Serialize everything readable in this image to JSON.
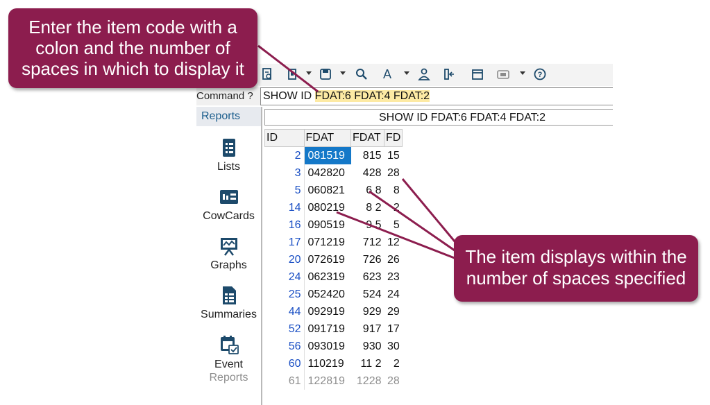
{
  "callouts": {
    "top": [
      "Enter the item code with a",
      "colon and the number of",
      "spaces in which to display it"
    ],
    "right": [
      "The item displays within the",
      "number of spaces specified"
    ]
  },
  "toolbar": {
    "icons": [
      "report-icon",
      "clipboard-icon",
      "save-icon",
      "search-icon",
      "font-icon",
      "user-icon",
      "column-icon",
      "calendar-icon",
      "screen-icon",
      "help-icon"
    ]
  },
  "command": {
    "label": "Command ?",
    "prefix": "SHOW ID ",
    "highlight": "FDAT:6 FDAT:4 FDAT:2"
  },
  "sidebar": {
    "header": "Reports",
    "items": [
      {
        "label": "Lists",
        "icon": "list-icon"
      },
      {
        "label": "CowCards",
        "icon": "cowcard-icon"
      },
      {
        "label": "Graphs",
        "icon": "graph-icon"
      },
      {
        "label": "Summaries",
        "icon": "summary-icon"
      },
      {
        "label": "Event",
        "label2": "Reports",
        "icon": "event-report-icon"
      }
    ]
  },
  "report": {
    "title": "SHOW ID FDAT:6 FDAT:4 FDAT:2",
    "headers": [
      "ID",
      "FDAT",
      "FDAT",
      "FD"
    ],
    "rows": [
      [
        "2",
        "081519",
        "815",
        "15"
      ],
      [
        "3",
        "042820",
        "428",
        "28"
      ],
      [
        "5",
        "060821",
        "6 8",
        "8"
      ],
      [
        "14",
        "080219",
        "8 2",
        "2"
      ],
      [
        "16",
        "090519",
        "9 5",
        "5"
      ],
      [
        "17",
        "071219",
        "712",
        "12"
      ],
      [
        "20",
        "072619",
        "726",
        "26"
      ],
      [
        "24",
        "062319",
        "623",
        "23"
      ],
      [
        "25",
        "052420",
        "524",
        "24"
      ],
      [
        "44",
        "092919",
        "929",
        "29"
      ],
      [
        "52",
        "091719",
        "917",
        "17"
      ],
      [
        "56",
        "093019",
        "930",
        "30"
      ],
      [
        "60",
        "110219",
        "11 2",
        "2"
      ],
      [
        "61",
        "122819",
        "1228",
        "28"
      ]
    ]
  },
  "colors": {
    "callout": "#8c1d4e",
    "highlight": "#fdeaa4",
    "selection": "#1478c8",
    "id_text": "#1a4fc4"
  }
}
